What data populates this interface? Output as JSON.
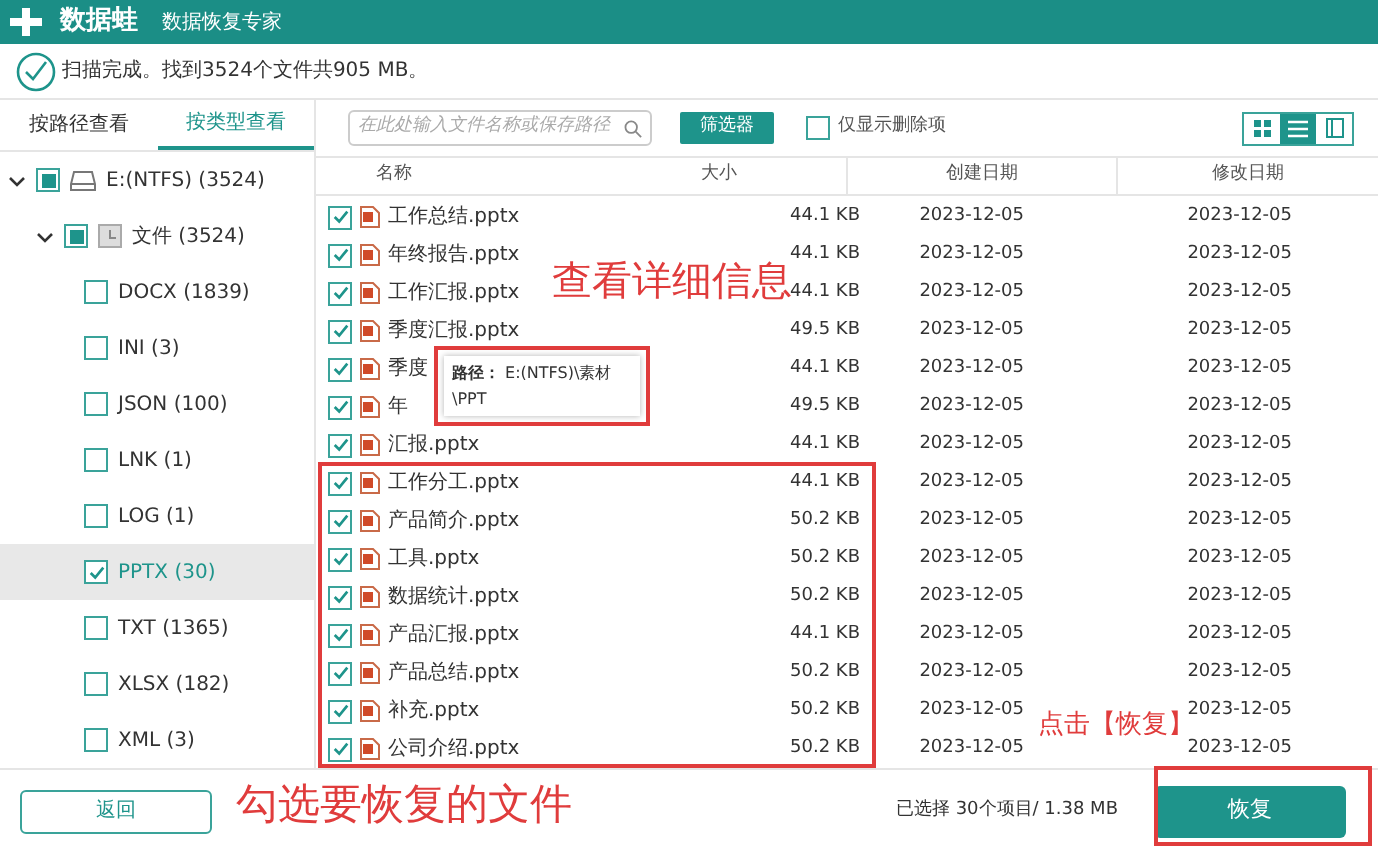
{
  "app": {
    "name": "数据蛙",
    "subtitle": "数据恢复专家"
  },
  "status": "扫描完成。找到3524个文件共905 MB。",
  "tabs": [
    {
      "label": "按路径查看",
      "selected": false
    },
    {
      "label": "按类型查看",
      "selected": true
    }
  ],
  "search": {
    "placeholder": "在此处输入文件名称或保存路径"
  },
  "filter_button": "筛选器",
  "deleted_only": {
    "label": "仅显示删除项",
    "checked": false
  },
  "view_modes": [
    {
      "kind": "grid",
      "selected": false
    },
    {
      "kind": "list",
      "selected": true
    },
    {
      "kind": "detail",
      "selected": false
    }
  ],
  "tree": [
    {
      "label": "E:(NTFS) (3524)",
      "kind": "drive",
      "checked": false,
      "partial": true,
      "expanded": true,
      "selected": false,
      "children": [
        {
          "label": "文件 (3524)",
          "kind": "folder",
          "checked": false,
          "partial": true,
          "expanded": true,
          "selected": false,
          "children": [
            {
              "label": "DOCX (1839)",
              "checked": false,
              "selected": false
            },
            {
              "label": "INI (3)",
              "checked": false,
              "selected": false
            },
            {
              "label": "JSON (100)",
              "checked": false,
              "selected": false
            },
            {
              "label": "LNK (1)",
              "checked": false,
              "selected": false
            },
            {
              "label": "LOG (1)",
              "checked": false,
              "selected": false
            },
            {
              "label": "PPTX (30)",
              "checked": true,
              "selected": true
            },
            {
              "label": "TXT (1365)",
              "checked": false,
              "selected": false
            },
            {
              "label": "XLSX (182)",
              "checked": false,
              "selected": false
            },
            {
              "label": "XML (3)",
              "checked": false,
              "selected": false
            }
          ]
        }
      ]
    }
  ],
  "table": {
    "columns": [
      "名称",
      "大小",
      "创建日期",
      "修改日期"
    ],
    "rows": [
      {
        "name": "工作总结.pptx",
        "size": "44.1 KB",
        "created": "2023-12-05",
        "modified": "2023-12-05",
        "checked": true
      },
      {
        "name": "年终报告.pptx",
        "size": "44.1 KB",
        "created": "2023-12-05",
        "modified": "2023-12-05",
        "checked": true
      },
      {
        "name": "工作汇报.pptx",
        "size": "44.1 KB",
        "created": "2023-12-05",
        "modified": "2023-12-05",
        "checked": true
      },
      {
        "name": "季度汇报.pptx",
        "size": "49.5 KB",
        "created": "2023-12-05",
        "modified": "2023-12-05",
        "checked": true
      },
      {
        "name": "季度",
        "size": "44.1 KB",
        "created": "2023-12-05",
        "modified": "2023-12-05",
        "checked": true
      },
      {
        "name": "年",
        "size": "49.5 KB",
        "created": "2023-12-05",
        "modified": "2023-12-05",
        "checked": true
      },
      {
        "name": "汇报.pptx",
        "size": "44.1 KB",
        "created": "2023-12-05",
        "modified": "2023-12-05",
        "checked": true
      },
      {
        "name": "工作分工.pptx",
        "size": "44.1 KB",
        "created": "2023-12-05",
        "modified": "2023-12-05",
        "checked": true
      },
      {
        "name": "产品简介.pptx",
        "size": "50.2 KB",
        "created": "2023-12-05",
        "modified": "2023-12-05",
        "checked": true
      },
      {
        "name": "工具.pptx",
        "size": "50.2 KB",
        "created": "2023-12-05",
        "modified": "2023-12-05",
        "checked": true
      },
      {
        "name": "数据统计.pptx",
        "size": "50.2 KB",
        "created": "2023-12-05",
        "modified": "2023-12-05",
        "checked": true
      },
      {
        "name": "产品汇报.pptx",
        "size": "44.1 KB",
        "created": "2023-12-05",
        "modified": "2023-12-05",
        "checked": true
      },
      {
        "name": "产品总结.pptx",
        "size": "50.2 KB",
        "created": "2023-12-05",
        "modified": "2023-12-05",
        "checked": true
      },
      {
        "name": "补充.pptx",
        "size": "50.2 KB",
        "created": "2023-12-05",
        "modified": "2023-12-05",
        "checked": true
      },
      {
        "name": "公司介绍.pptx",
        "size": "50.2 KB",
        "created": "2023-12-05",
        "modified": "2023-12-05",
        "checked": true
      }
    ]
  },
  "tooltip": {
    "label": "路径：",
    "value": "E:(NTFS)\\素材\\PPT"
  },
  "back_button": "返回",
  "selection_summary": "已选择 30个项目/ 1.38 MB",
  "recover_button": "恢复",
  "annotations": [
    "查看详细信息",
    "勾选要恢复的文件",
    "点击【恢复】"
  ]
}
